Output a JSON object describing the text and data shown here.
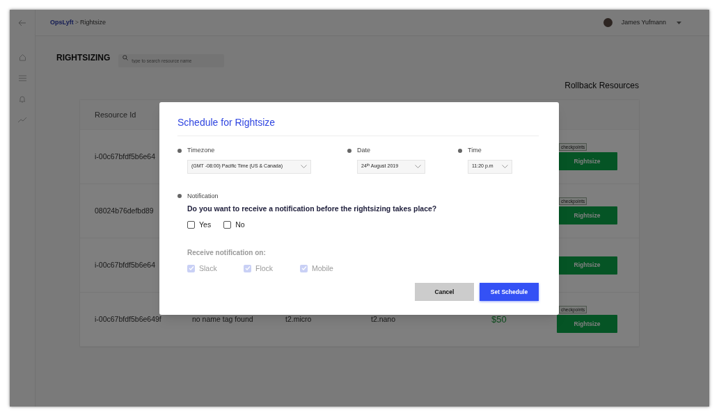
{
  "breadcrumb": {
    "parent": "OpsLyft",
    "separator": ">",
    "current": "Rightsize"
  },
  "user": {
    "name": "James Yufmann"
  },
  "page_title": "RIGHTSIZING",
  "search": {
    "placeholder": "type to search resource name"
  },
  "rollback_link": "Rollback Resources",
  "table": {
    "columns": [
      "Resource Id"
    ],
    "rows": [
      {
        "cells": [
          "i-00c67bfdf5b6e64"
        ],
        "tag": "checkpoints",
        "action": "Rightsize"
      },
      {
        "cells": [
          "08024b76defbd89"
        ],
        "tag": "checkpoints",
        "action": "Rightsize"
      },
      {
        "cells": [
          "i-00c67bfdf5b6e64"
        ],
        "action": "Rightsize"
      },
      {
        "cells": [
          "i-00c67bfdf5b6e649f",
          "no name tag found",
          "t2.micro",
          "t2.nano",
          "$50"
        ],
        "tag": "checkpoints",
        "action": "Rightsize"
      }
    ]
  },
  "modal": {
    "title": "Schedule for Rightsize",
    "fields": [
      {
        "label": "Timezone",
        "value": "(GMT -08:00) Pacific Time (US & Canada)"
      },
      {
        "label": "Date",
        "value": "24$^{th}$ August 2019"
      },
      {
        "label": "Time",
        "value": "11:20 p.m"
      }
    ],
    "notification": {
      "label": "Notification",
      "question": "Do you want to receive a notification before the rightsizing takes place?",
      "options": [
        {
          "label": "Yes",
          "checked": false
        },
        {
          "label": "No",
          "checked": false
        }
      ]
    },
    "channels": {
      "label": "Receive notification on:",
      "disabled": true,
      "options": [
        {
          "label": "Slack",
          "checked": true
        },
        {
          "label": "Flock",
          "checked": true
        },
        {
          "label": "Mobile",
          "checked": true
        }
      ]
    },
    "buttons": [
      {
        "label": "Cancel",
        "kind": "secondary"
      },
      {
        "label": "Set Schedule",
        "kind": "primary"
      }
    ]
  }
}
